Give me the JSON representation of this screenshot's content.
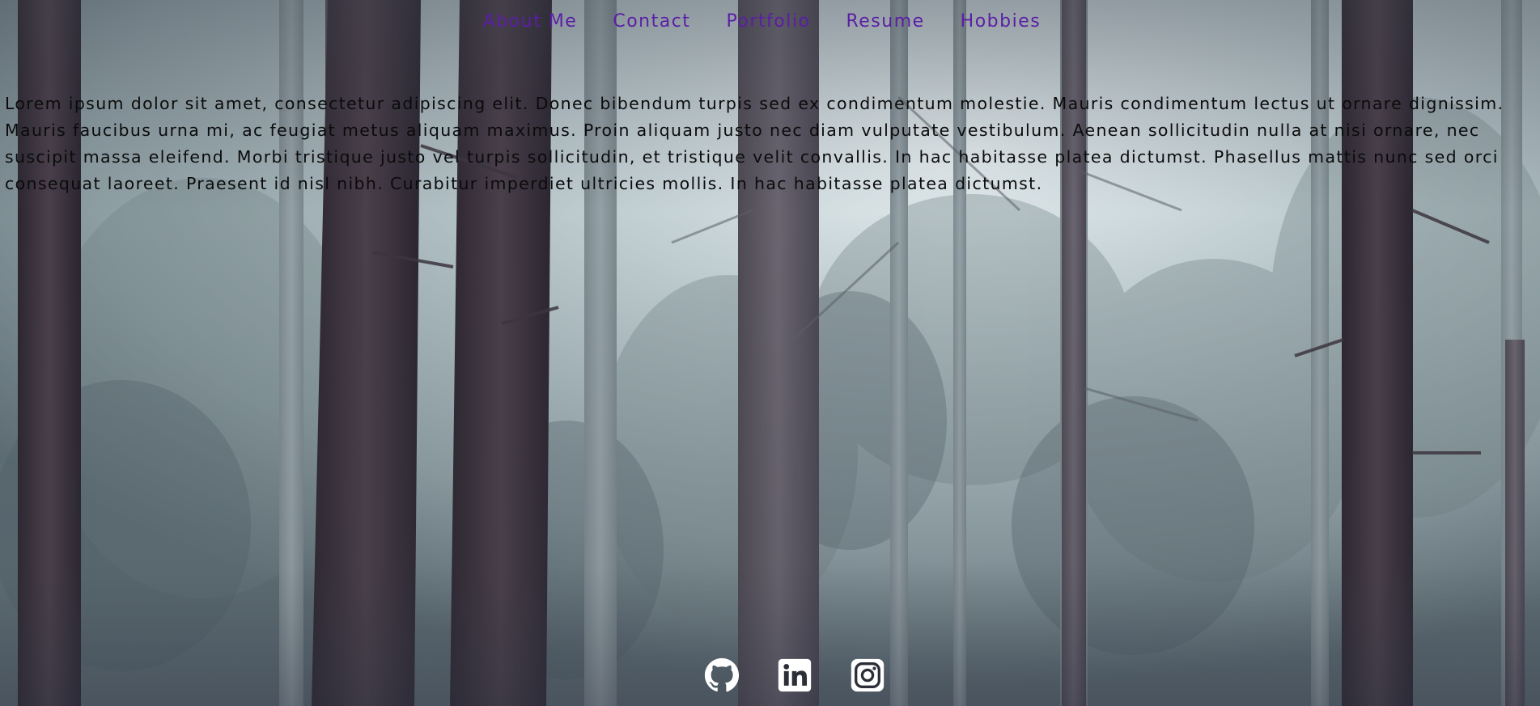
{
  "nav": {
    "items": [
      {
        "label": "About Me"
      },
      {
        "label": "Contact"
      },
      {
        "label": "Portfolio"
      },
      {
        "label": "Resume"
      },
      {
        "label": "Hobbies"
      }
    ]
  },
  "intro": {
    "text": "Lorem ipsum dolor sit amet, consectetur adipiscing elit. Donec bibendum turpis sed ex condimentum molestie. Mauris condimentum lectus ut ornare dignissim. Mauris faucibus urna mi, ac feugiat metus aliquam maximus. Proin aliquam justo nec diam vulputate vestibulum. Aenean sollicitudin nulla at nisi ornare, nec suscipit massa eleifend. Morbi tristique justo vel turpis sollicitudin, et tristique velit convallis. In hac habitasse platea dictumst. Phasellus mattis nunc sed orci consequat laoreet. Praesent id nisl nibh. Curabitur imperdiet ultricies mollis. In hac habitasse platea dictumst."
  },
  "social": {
    "items": [
      {
        "icon": "github-icon"
      },
      {
        "icon": "linkedin-icon"
      },
      {
        "icon": "instagram-icon"
      }
    ]
  },
  "colors": {
    "nav_link": "#5b1ea6",
    "body_text": "#0b0b0b",
    "icon_fill": "#ffffff",
    "background_fog": "#9fb0b4"
  }
}
